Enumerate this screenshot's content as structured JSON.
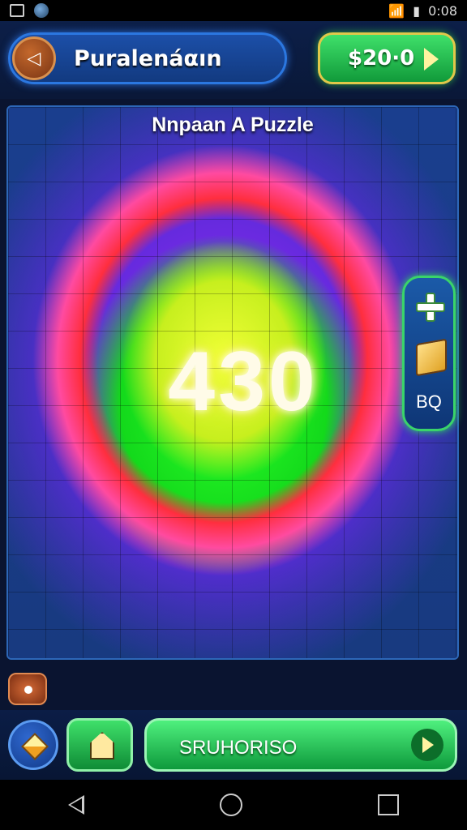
{
  "status_bar": {
    "time": "0:08"
  },
  "header": {
    "title": "Puralenáαın",
    "coins": "$20·0"
  },
  "board": {
    "title": "Nnpaan A Puzzle",
    "score": "430"
  },
  "side_panel": {
    "label": "BQ"
  },
  "bottom": {
    "action_label": "SRUHORISO"
  },
  "colors": {
    "accent_green": "#1fc44e",
    "panel_blue": "#1c4fa8",
    "board_blue": "#102c66"
  },
  "icons": [
    "back-icon",
    "arrow-right-icon",
    "plus-icon",
    "puzzle-piece-icon",
    "diamond-icon",
    "home-icon",
    "nav-back-icon",
    "nav-home-icon",
    "nav-recent-icon"
  ]
}
